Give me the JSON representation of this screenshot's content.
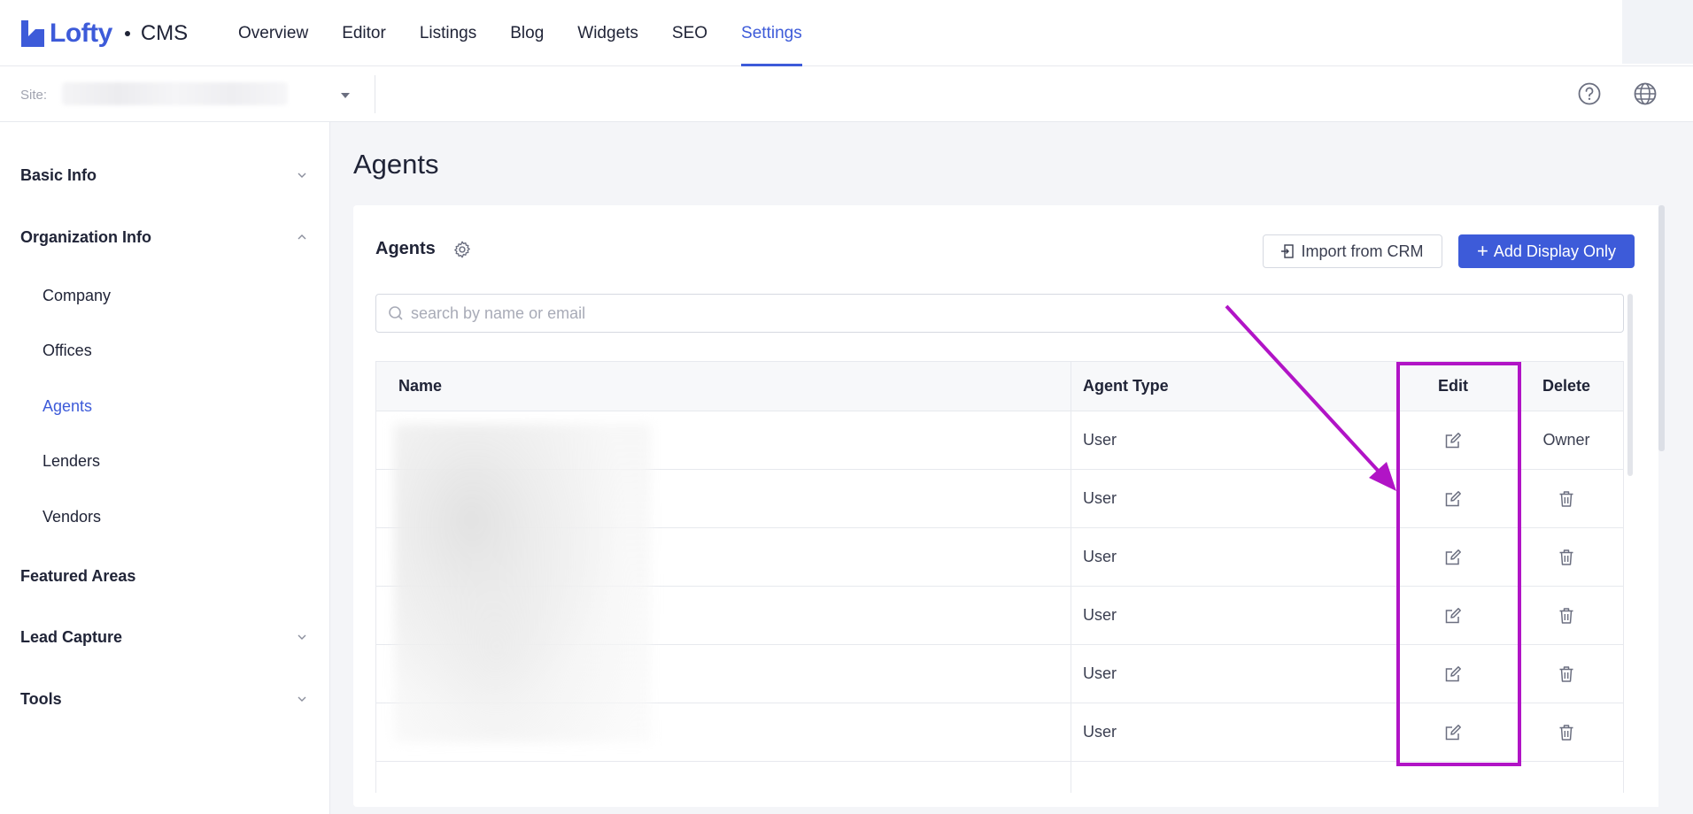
{
  "brand": {
    "name": "Lofty",
    "product": "CMS"
  },
  "nav": [
    {
      "label": "Overview",
      "active": false
    },
    {
      "label": "Editor",
      "active": false
    },
    {
      "label": "Listings",
      "active": false
    },
    {
      "label": "Blog",
      "active": false
    },
    {
      "label": "Widgets",
      "active": false
    },
    {
      "label": "SEO",
      "active": false
    },
    {
      "label": "Settings",
      "active": true
    }
  ],
  "subbar": {
    "site_label": "Site:"
  },
  "sidebar": {
    "groups": [
      {
        "label": "Basic Info",
        "chevron": "down"
      },
      {
        "label": "Organization Info",
        "chevron": "up"
      },
      {
        "label": "Featured Areas",
        "chevron": "none"
      },
      {
        "label": "Lead Capture",
        "chevron": "down"
      },
      {
        "label": "Tools",
        "chevron": "down"
      }
    ],
    "sub_items": [
      {
        "label": "Company",
        "active": false
      },
      {
        "label": "Offices",
        "active": false
      },
      {
        "label": "Agents",
        "active": true
      },
      {
        "label": "Lenders",
        "active": false
      },
      {
        "label": "Vendors",
        "active": false
      }
    ]
  },
  "main": {
    "page_title": "Agents",
    "card_title": "Agents",
    "import_label": "Import from CRM",
    "add_label": "Add Display Only",
    "search_placeholder": "search by name or email"
  },
  "table": {
    "columns": [
      "Name",
      "Agent Type",
      "Edit",
      "Delete"
    ],
    "rows": [
      {
        "agent_type": "User",
        "delete": "Owner"
      },
      {
        "agent_type": "User",
        "delete": "trash-icon"
      },
      {
        "agent_type": "User",
        "delete": "trash-icon"
      },
      {
        "agent_type": "User",
        "delete": "trash-icon"
      },
      {
        "agent_type": "User",
        "delete": "trash-icon"
      },
      {
        "agent_type": "User",
        "delete": "trash-icon"
      }
    ]
  },
  "colors": {
    "accent": "#3d5bd9",
    "annotation": "#b114c6",
    "text": "#202437",
    "muted": "#a0a3af"
  }
}
